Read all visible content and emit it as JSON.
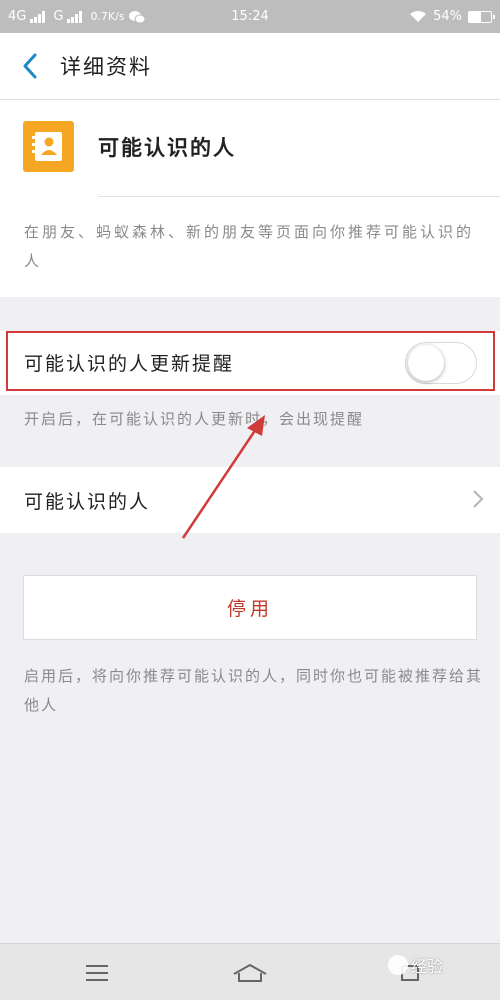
{
  "status_bar": {
    "network1": "4G",
    "network2": "G",
    "speed": "0.7K/s",
    "time": "15:24",
    "battery": "54%",
    "battery_level": 0.54
  },
  "nav": {
    "title": "详细资料"
  },
  "app": {
    "name": "可能认识的人",
    "description": "在朋友、蚂蚁森林、新的朋友等页面向你推荐可能认识的人",
    "icon_color": "#f5a623"
  },
  "reminder": {
    "label": "可能认识的人更新提醒",
    "enabled": false,
    "hint": "开启后，在可能认识的人更新时，会出现提醒"
  },
  "people_row": {
    "label": "可能认识的人"
  },
  "disable": {
    "label": "停用",
    "hint": "启用后，将向你推荐可能认识的人，同时你也可能被推荐给其他人",
    "color": "#c0392b"
  },
  "annotation": {
    "highlight_color": "#d23a3a"
  },
  "watermark": {
    "text": "经验"
  }
}
